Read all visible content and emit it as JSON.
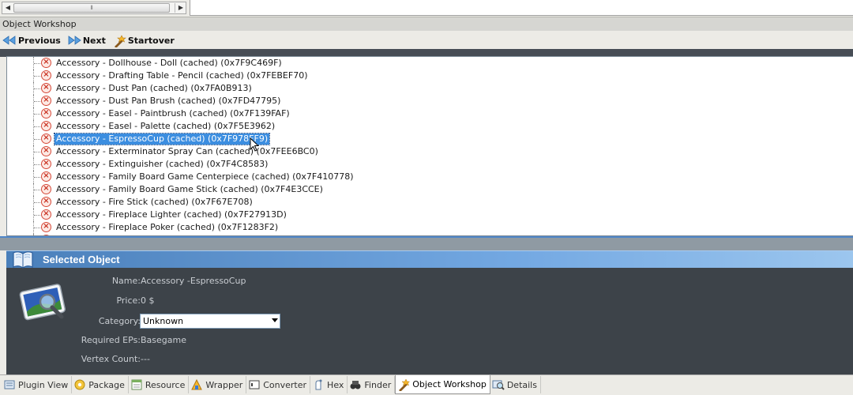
{
  "window": {
    "title": "Object Workshop"
  },
  "nav": {
    "previous": "Previous",
    "next": "Next",
    "startover": "Startover"
  },
  "tree": {
    "items": [
      {
        "label": "Accessory - Dollhouse - Doll (cached) (0x7F9C469F)",
        "selected": false
      },
      {
        "label": "Accessory - Drafting Table - Pencil (cached) (0x7FEBEF70)",
        "selected": false
      },
      {
        "label": "Accessory - Dust Pan (cached) (0x7FA0B913)",
        "selected": false
      },
      {
        "label": "Accessory - Dust Pan Brush (cached) (0x7FD47795)",
        "selected": false
      },
      {
        "label": "Accessory - Easel - Paintbrush (cached) (0x7F139FAF)",
        "selected": false
      },
      {
        "label": "Accessory - Easel - Palette (cached) (0x7F5E3962)",
        "selected": false
      },
      {
        "label": "Accessory - EspressoCup (cached) (0x7F978FF9)",
        "selected": true
      },
      {
        "label": "Accessory - Exterminator Spray Can (cached) (0x7FEE6BC0)",
        "selected": false
      },
      {
        "label": "Accessory - Extinguisher (cached) (0x7F4C8583)",
        "selected": false
      },
      {
        "label": "Accessory - Family Board Game Centerpiece (cached) (0x7F410778)",
        "selected": false
      },
      {
        "label": "Accessory - Family Board Game Stick (cached) (0x7F4E3CCE)",
        "selected": false
      },
      {
        "label": "Accessory - Fire Stick (cached) (0x7F67E708)",
        "selected": false
      },
      {
        "label": "Accessory - Fireplace Lighter (cached) (0x7F27913D)",
        "selected": false
      },
      {
        "label": "Accessory - Fireplace Poker (cached) (0x7F1283F2)",
        "selected": false
      }
    ]
  },
  "selected_object": {
    "header": "Selected Object",
    "name_label": "Name:",
    "name_value": "Accessory -EspressoCup",
    "price_label": "Price:",
    "price_value": "0 $",
    "category_label": "Category:",
    "category_value": "Unknown",
    "eps_label": "Required EPs:",
    "eps_value": "Basegame",
    "vertex_label": "Vertex Count:",
    "vertex_value": "---"
  },
  "tabs": [
    {
      "label": "Plugin View",
      "active": false
    },
    {
      "label": "Package",
      "active": false
    },
    {
      "label": "Resource",
      "active": false
    },
    {
      "label": "Wrapper",
      "active": false
    },
    {
      "label": "Converter",
      "active": false
    },
    {
      "label": "Hex",
      "active": false
    },
    {
      "label": "Finder",
      "active": false
    },
    {
      "label": "Object Workshop",
      "active": true
    },
    {
      "label": "Details",
      "active": false
    }
  ],
  "colors": {
    "selection": "#3c8ee0",
    "panel_bg": "#3d4349",
    "header_gradient_start": "#4a7fba",
    "error_icon": "#d64a3a"
  }
}
